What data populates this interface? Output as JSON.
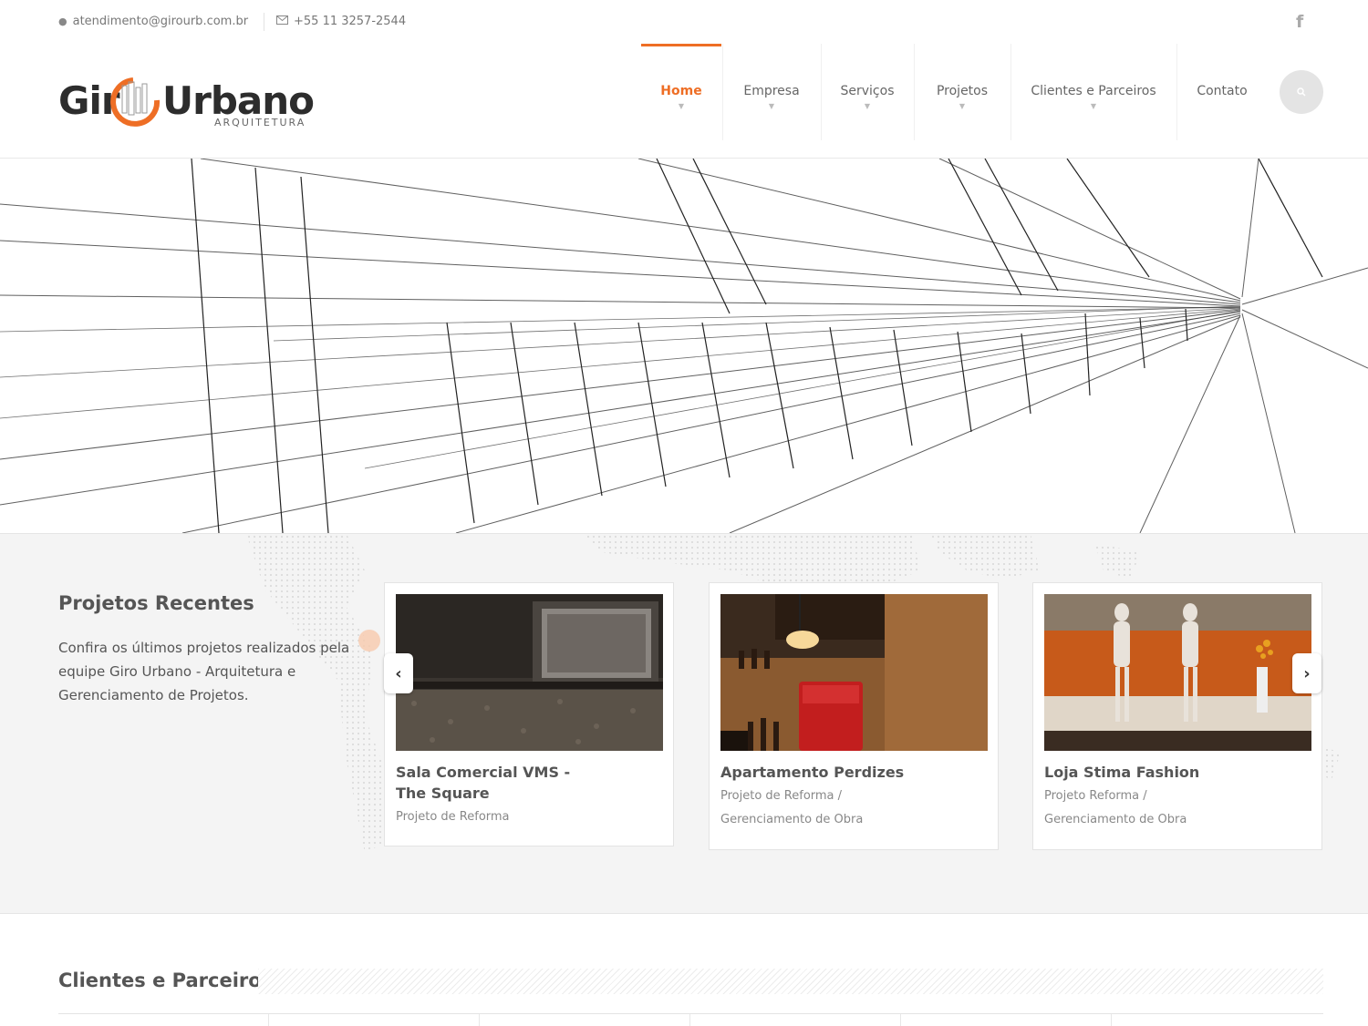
{
  "topbar": {
    "email": "atendimento@girourb.com.br",
    "phone": "+55 11 3257-2544",
    "social_icon": "facebook-icon"
  },
  "logo": {
    "word_left": "Gir",
    "word_right": "Urbano",
    "subtitle": "ARQUITETURA",
    "accent": "#ee6e25"
  },
  "nav": {
    "items": [
      {
        "label": "Home",
        "active": true
      },
      {
        "label": "Empresa"
      },
      {
        "label": "Serviços"
      },
      {
        "label": "Projetos"
      },
      {
        "label": "Clientes e Parceiros"
      },
      {
        "label": "Contato"
      }
    ],
    "caret": "▼",
    "search_icon": "search-icon"
  },
  "recent": {
    "title": "Projetos Recentes",
    "description": "Confira os últimos projetos realizados pela equipe Giro Urbano - Arquitetura e Gerenciamento de Projetos.",
    "cards": [
      {
        "title": "Sala Comercial VMS - The Square",
        "subtitle": "Projeto de Reforma"
      },
      {
        "title": "Apartamento Perdizes",
        "subtitle": "Projeto de Reforma /",
        "subtitle2": "Gerenciamento de Obra"
      },
      {
        "title": "Loja Stima Fashion",
        "subtitle": "Projeto Reforma /",
        "subtitle2": "Gerenciamento de Obra"
      }
    ],
    "prev_label": "‹",
    "next_label": "›"
  },
  "clients": {
    "title": "Clientes e Parceiros"
  },
  "colors": {
    "accent": "#ee6e25",
    "text": "#555555",
    "muted": "#888888",
    "section_bg": "#f4f4f4"
  }
}
